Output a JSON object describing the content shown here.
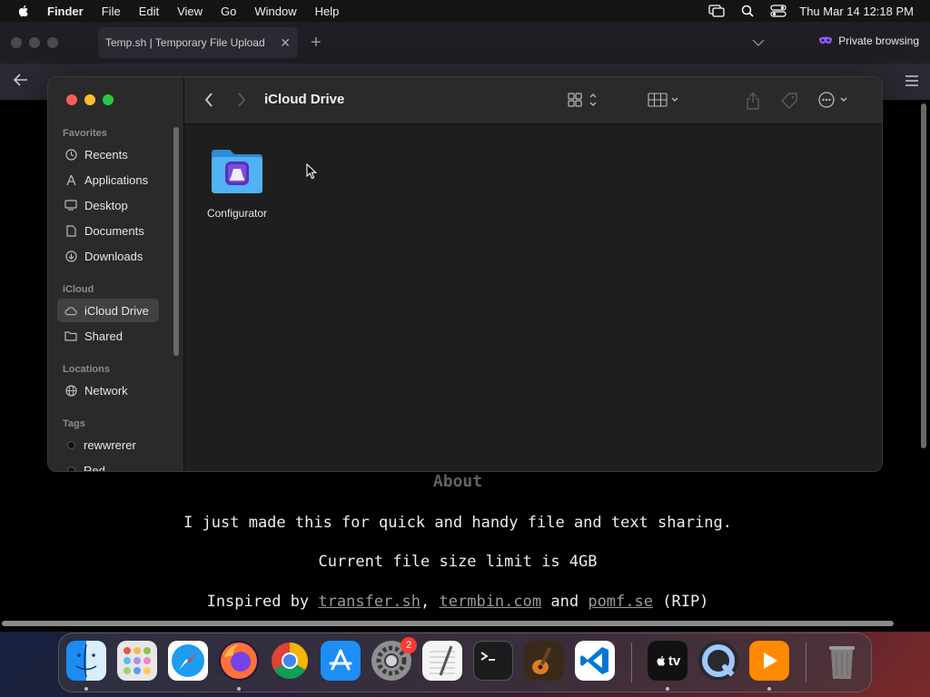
{
  "menubar": {
    "app": "Finder",
    "items": [
      "File",
      "Edit",
      "View",
      "Go",
      "Window",
      "Help"
    ],
    "clock": "Thu Mar 14  12:18 PM"
  },
  "browser": {
    "tab_title": "Temp.sh | Temporary File Upload",
    "tab_close": "✕",
    "new_tab": "+",
    "private_label": "Private browsing",
    "about_heading": "About",
    "line1": "I just made this for quick and handy file and text sharing.",
    "line2": "Current file size limit is 4GB",
    "line3_prefix": "Inspired by",
    "link1": "transfer.sh",
    "comma": ",",
    "link2": "termbin.com",
    "and": "and",
    "link3": "pomf.se",
    "suffix": "(RIP)"
  },
  "finder": {
    "title": "iCloud Drive",
    "sections": {
      "favorites": "Favorites",
      "icloud": "iCloud",
      "locations": "Locations",
      "tags": "Tags"
    },
    "favorites": [
      {
        "label": "Recents",
        "icon": "clock-icon"
      },
      {
        "label": "Applications",
        "icon": "applications-icon"
      },
      {
        "label": "Desktop",
        "icon": "desktop-icon"
      },
      {
        "label": "Documents",
        "icon": "document-icon"
      },
      {
        "label": "Downloads",
        "icon": "download-icon"
      }
    ],
    "icloud_items": [
      {
        "label": "iCloud Drive",
        "icon": "cloud-icon",
        "selected": true
      },
      {
        "label": "Shared",
        "icon": "shared-folder-icon"
      }
    ],
    "locations": [
      {
        "label": "Network",
        "icon": "network-icon"
      }
    ],
    "tags": [
      {
        "label": "rewwrerer",
        "color": "#111111"
      },
      {
        "label": "Red",
        "color": "#111111"
      }
    ],
    "files": [
      {
        "name": "Configurator",
        "icon": "folder-icon"
      }
    ]
  },
  "dock": {
    "apps": [
      "Finder",
      "Launchpad",
      "Safari",
      "Firefox",
      "Chrome",
      "App Store",
      "System Settings",
      "TextEdit",
      "Terminal",
      "GarageBand",
      "Visual Studio Code",
      "Apple TV",
      "QuickTime Player",
      "Infuse",
      "Trash"
    ],
    "settings_badge": "2",
    "tv_label": "tv"
  }
}
